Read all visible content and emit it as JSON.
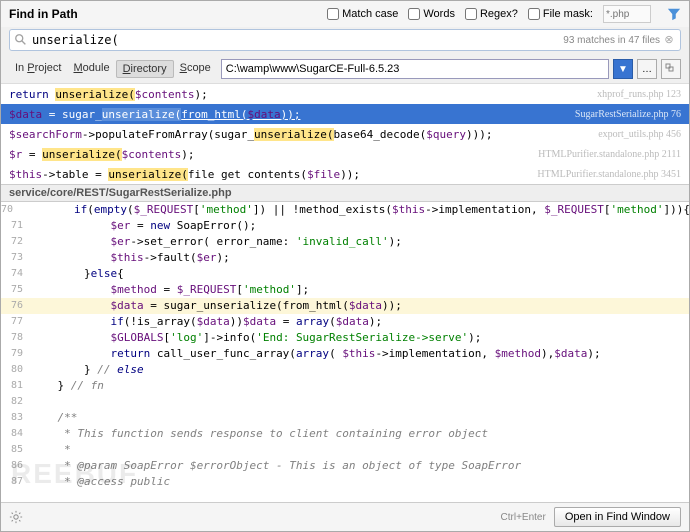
{
  "title": "Find in Path",
  "options": {
    "match_case": "Match case",
    "words": "Words",
    "regex": "Regex?",
    "file_mask": "File mask:",
    "mask_value": "*.php"
  },
  "search": {
    "query": "unserialize(",
    "match_info": "93 matches in 47 files"
  },
  "scope": {
    "tabs": [
      "In Project",
      "Module",
      "Directory",
      "Scope"
    ],
    "active": 2,
    "directory": "C:\\wamp\\www\\SugarCE-Full-6.5.23"
  },
  "results": [
    {
      "pre": "return ",
      "hl": "unserialize(",
      "post": "$contents);",
      "file": "xhprof_runs.php 123"
    },
    {
      "pre": "$data = sugar_",
      "hl": "unserialize(",
      "post": "from_html($data));",
      "file": "SugarRestSerialize.php 76",
      "selected": true,
      "underline_post": true
    },
    {
      "pre": "$searchForm->populateFromArray(sugar_",
      "hl": "unserialize(",
      "post": "base64_decode($query)));",
      "file": "export_utils.php 456"
    },
    {
      "pre": "$r = ",
      "hl": "unserialize(",
      "post": "$contents);",
      "file": "HTMLPurifier.standalone.php 2111"
    },
    {
      "pre": "$this->table = ",
      "hl": "unserialize(",
      "post": "file get contents($file));",
      "file": "HTMLPurifier.standalone.php 3451"
    }
  ],
  "preview_path": "service/core/REST/SugarRestSerialize.php",
  "code": [
    {
      "ln": 70,
      "raw": "        if(empty($_REQUEST['method']) || !method_exists($this->implementation, $_REQUEST['method'])){"
    },
    {
      "ln": 71,
      "raw": "            $er = new SoapError();"
    },
    {
      "ln": 72,
      "raw": "            $er->set_error( error_name: 'invalid_call');"
    },
    {
      "ln": 73,
      "raw": "            $this->fault($er);"
    },
    {
      "ln": 74,
      "raw": "        }else{"
    },
    {
      "ln": 75,
      "raw": "            $method = $_REQUEST['method'];"
    },
    {
      "ln": 76,
      "raw": "            $data = sugar_unserialize(from_html($data));",
      "hl": true
    },
    {
      "ln": 77,
      "raw": "            if(!is_array($data))$data = array($data);"
    },
    {
      "ln": 78,
      "raw": "            $GLOBALS['log']->info('End: SugarRestSerialize->serve');"
    },
    {
      "ln": 79,
      "raw": "            return call_user_func_array(array( $this->implementation, $method),$data);"
    },
    {
      "ln": 80,
      "raw": "        } // else"
    },
    {
      "ln": 81,
      "raw": "    } // fn"
    },
    {
      "ln": 82,
      "raw": ""
    },
    {
      "ln": 83,
      "raw": "    /**"
    },
    {
      "ln": 84,
      "raw": "     * This function sends response to client containing error object"
    },
    {
      "ln": 85,
      "raw": "     *"
    },
    {
      "ln": 86,
      "raw": "     * @param SoapError $errorObject - This is an object of type SoapError"
    },
    {
      "ln": 87,
      "raw": "     * @access public"
    }
  ],
  "footer": {
    "hint": "Ctrl+Enter",
    "button": "Open in Find Window"
  },
  "watermark": "REEBUF"
}
